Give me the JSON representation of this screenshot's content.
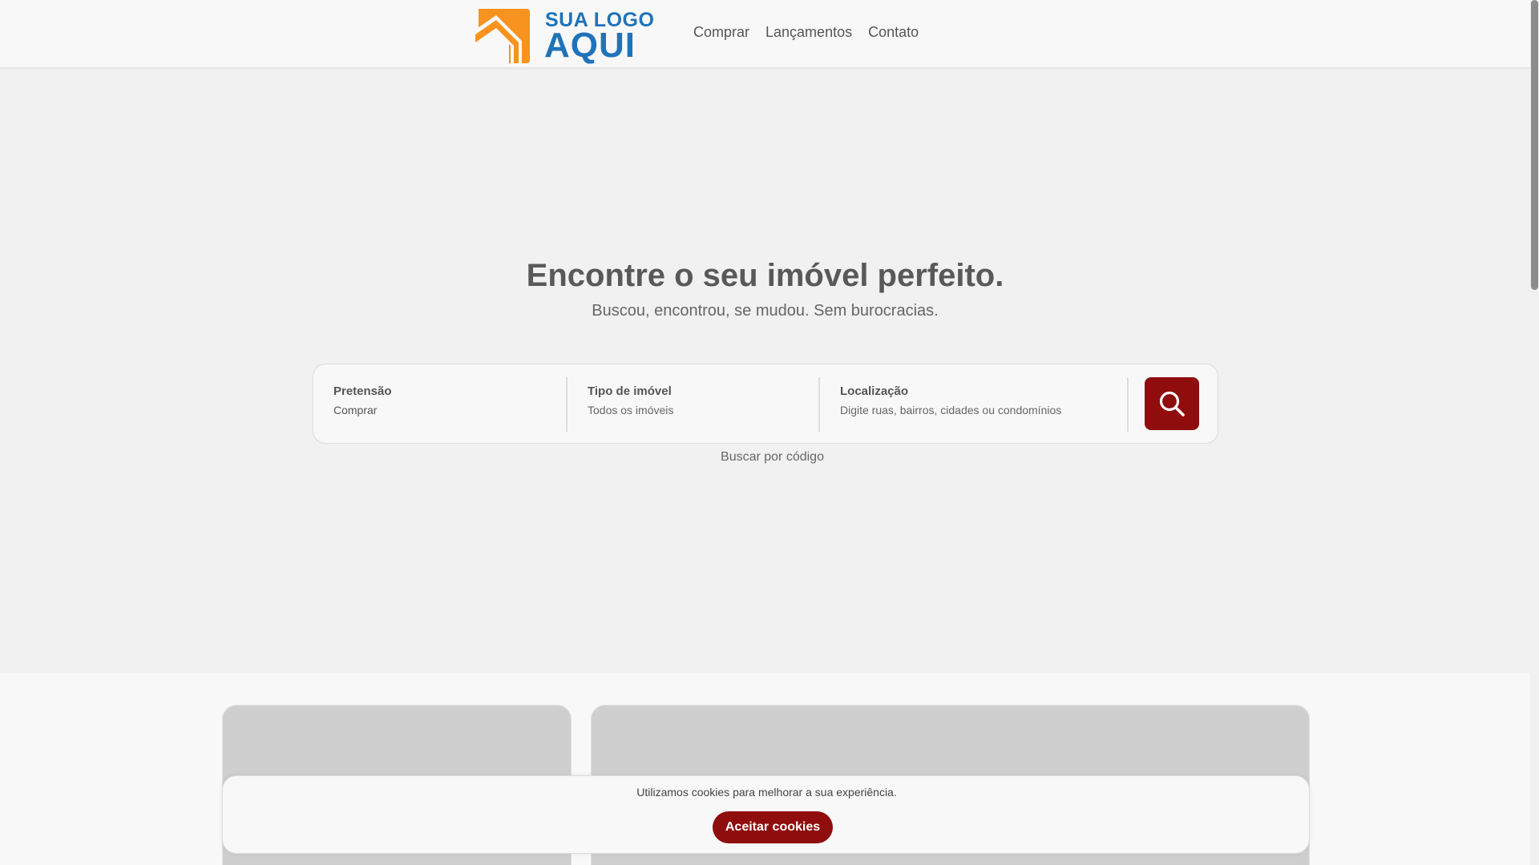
{
  "header": {
    "logo": {
      "line1": "SUA LOGO",
      "line2": "AQUI"
    },
    "nav": [
      "Comprar",
      "Lançamentos",
      "Contato"
    ]
  },
  "hero": {
    "title": "Encontre o seu imóvel perfeito.",
    "subtitle": "Buscou, encontrou, se mudou. Sem burocracias."
  },
  "search": {
    "fields": [
      {
        "label": "Pretensão",
        "value": "Comprar"
      },
      {
        "label": "Tipo de imóvel",
        "value": "Todos os imóveis"
      },
      {
        "label": "Localização",
        "value": "Digite ruas, bairros, cidades ou condomínios"
      }
    ],
    "search_icon": "search-icon",
    "code_link": "Buscar por código"
  },
  "cookie": {
    "text": "Utilizamos cookies para melhorar a sua experiência.",
    "button": "Aceitar cookies"
  },
  "colors": {
    "accent": "#8f0d0d",
    "logo_blue": "#1f73b8",
    "logo_orange": "#f7931e"
  }
}
